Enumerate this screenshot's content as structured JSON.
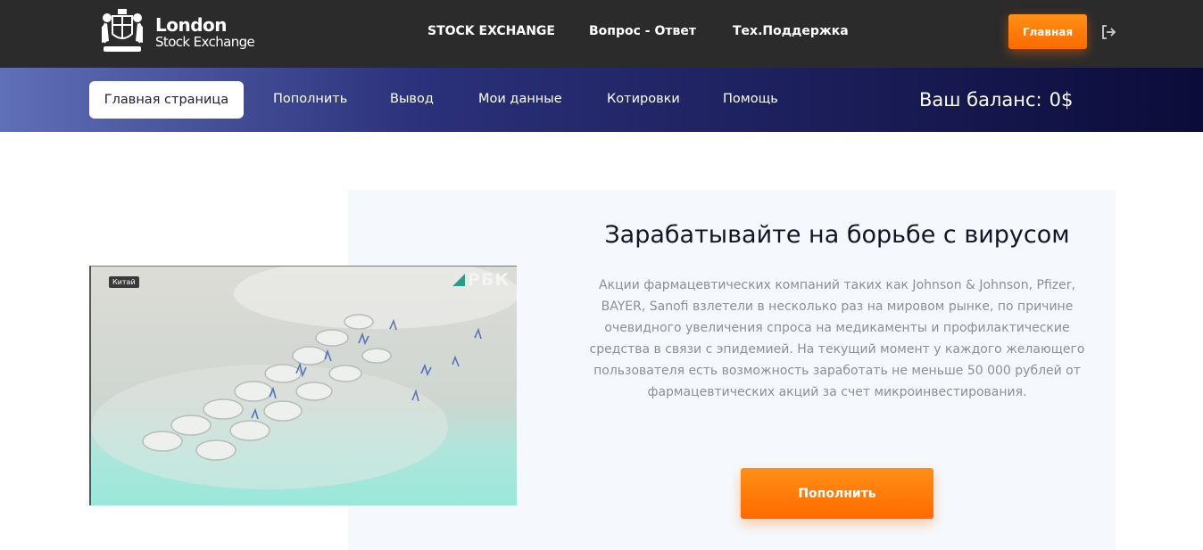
{
  "header": {
    "logo_line1": "London",
    "logo_line2": "Stock Exchange",
    "nav": [
      "STOCK EXCHANGE",
      "Вопрос - Ответ",
      "Тех.Поддержка"
    ],
    "main_button": "Главная",
    "logout_icon": "logout-icon"
  },
  "subnav": {
    "active_tab": "Главная страница",
    "tabs": [
      "Пополнить",
      "Вывод",
      "Мои данные",
      "Котировки",
      "Помощь"
    ],
    "balance_label": "Ваш баланс:",
    "balance_value": "0$"
  },
  "content": {
    "video_tag": "Китай",
    "video_brand": "РБК",
    "headline": "Зарабатывайте на борьбе с вирусом",
    "description": "Акции фармацевтических компаний таких как Johnson & Johnson, Pfizer, BAYER, Sanofi взлетели в несколько раз на мировом рынке, по причине очевидного увеличения спроса на медикаменты и профилактические средства в связи с эпидемией. На текущий момент у каждого желающего пользователя есть возможность заработать не меньше 50 000 рублей от фармацевтических акций за счет микроинвестирования.",
    "cta_button": "Пополнить"
  },
  "colors": {
    "topbar": "#2b2b2b",
    "accent_orange": "#ff7a0a",
    "subbar_start": "#5f6fb8",
    "subbar_end": "#0c0c3a",
    "panel_bg": "#f5f9fd"
  }
}
